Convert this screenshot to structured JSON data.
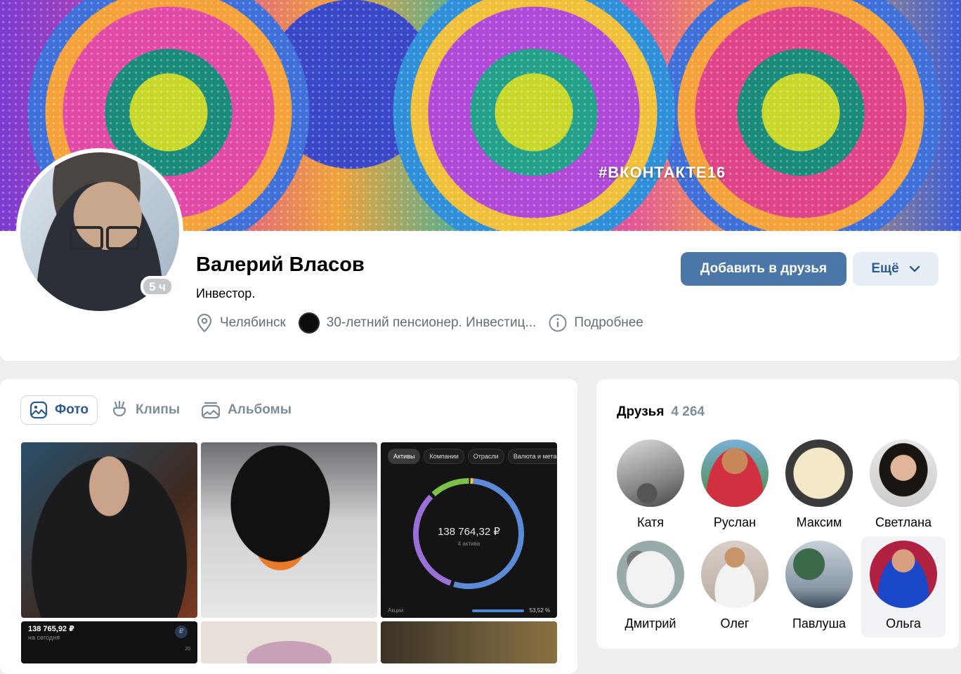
{
  "cover": {
    "hashtag": "#ВКОНТАКТЕ16"
  },
  "profile": {
    "name": "Валерий Власов",
    "status": "Инвестор.",
    "online_badge": "5 ч",
    "city": "Челябинск",
    "group": "30-летний пенсионер. Инвестиц...",
    "details_link": "Подробнее",
    "add_friend_button": "Добавить в друзья",
    "more_button": "Ещё"
  },
  "media": {
    "tabs": [
      {
        "label": "Фото",
        "icon": "photo-icon",
        "active": true
      },
      {
        "label": "Клипы",
        "icon": "clips-icon",
        "active": false
      },
      {
        "label": "Альбомы",
        "icon": "albums-icon",
        "active": false
      }
    ],
    "portfolio_shot": {
      "chips": [
        "Активы",
        "Компании",
        "Отрасли",
        "Валюта и мета"
      ],
      "total": "138 764,32 ₽",
      "assets_count": "4 актива",
      "footer_label": "Акции",
      "footer_value": "53,52 %"
    },
    "portfolio_shot2": {
      "value": "138 765,92 ₽",
      "sub": "на сегодня",
      "badge": "₽",
      "year": "20"
    }
  },
  "friends": {
    "title": "Друзья",
    "count": "4 264",
    "list": [
      {
        "name": "Катя"
      },
      {
        "name": "Руслан"
      },
      {
        "name": "Максим"
      },
      {
        "name": "Светлана"
      },
      {
        "name": "Дмитрий"
      },
      {
        "name": "Олег"
      },
      {
        "name": "Павлуша"
      },
      {
        "name": "Ольга"
      }
    ]
  },
  "colors": {
    "primary": "#4a76a8",
    "secondary_bg": "#e8eef5",
    "muted_text": "#818c99",
    "page_bg": "#edeef0",
    "donut": [
      "#5a8ad8",
      "#9a6fd8",
      "#7cc24a",
      "#f5c542"
    ]
  }
}
